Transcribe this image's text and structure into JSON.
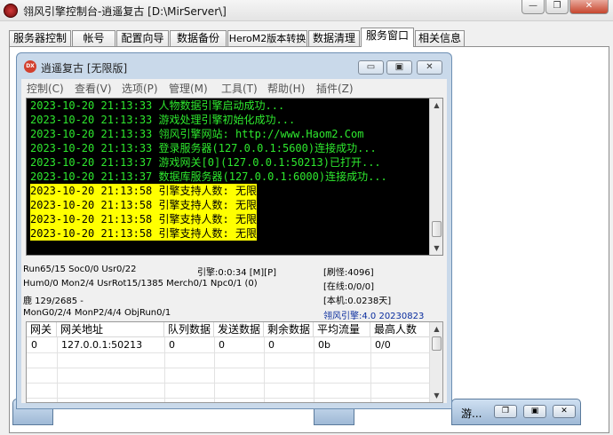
{
  "window": {
    "title": "翎风引擎控制台-逍遥复古 [D:\\MirServer\\]",
    "minimize_glyph": "—",
    "restore_glyph": "❐",
    "close_glyph": "✕"
  },
  "tabs": [
    {
      "label": "服务器控制"
    },
    {
      "label": "帐号"
    },
    {
      "label": "配置向导"
    },
    {
      "label": "数据备份"
    },
    {
      "label": "HeroM2版本转换"
    },
    {
      "label": "数据清理"
    },
    {
      "label": "服务窗口",
      "active": true
    },
    {
      "label": "相关信息"
    }
  ],
  "inner_window": {
    "icon_text": "DX",
    "title": "逍遥复古 [无限版]",
    "min_glyph": "▭",
    "max_glyph": "▣",
    "close_glyph": "✕",
    "menu": [
      "控制(C)",
      "查看(V)",
      "选项(P)",
      "管理(M)",
      "工具(T)",
      "帮助(H)",
      "插件(Z)"
    ]
  },
  "log": [
    {
      "text": "2023-10-20 21:13:33 人物数据引擎启动成功...",
      "highlight": false
    },
    {
      "text": "2023-10-20 21:13:33 游戏处理引擎初始化成功...",
      "highlight": false
    },
    {
      "text": "2023-10-20 21:13:33 翎风引擎网站: http://www.Haom2.Com",
      "highlight": false
    },
    {
      "text": "2023-10-20 21:13:33 登录服务器(127.0.0.1:5600)连接成功...",
      "highlight": false
    },
    {
      "text": "2023-10-20 21:13:37 游戏网关[0](127.0.0.1:50213)已打开...",
      "highlight": false
    },
    {
      "text": "2023-10-20 21:13:37 数据库服务器(127.0.0.1:6000)连接成功...",
      "highlight": false
    },
    {
      "text": "2023-10-20 21:13:58 引擎支持人数: 无限",
      "highlight": true
    },
    {
      "text": "2023-10-20 21:13:58 引擎支持人数: 无限",
      "highlight": true
    },
    {
      "text": "2023-10-20 21:13:58 引擎支持人数: 无限",
      "highlight": true
    },
    {
      "text": "2023-10-20 21:13:58 引擎支持人数: 无限",
      "highlight": true
    }
  ],
  "status": {
    "run": "Run65/15 Soc0/0 Usr0/22",
    "engine_time": "引擎:0:0:34 [M][P]",
    "refresh": "[刷怪:4096]",
    "hum": "Hum0/0 Mon2/4 UsrRot15/1385 Merch0/1 Npc0/1 (0)",
    "online": "[在线:0/0/0]",
    "deer": "鹿 129/2685 -",
    "local": "[本机:0.0238天]",
    "mon": "MonG0/2/4 MonP2/4/4 ObjRun0/1",
    "engine_version": "翎风引擎:4.0 20230823"
  },
  "gateway_table": {
    "headers": [
      "网关",
      "网关地址",
      "队列数据",
      "发送数据",
      "剩余数据",
      "平均流量",
      "最高人数"
    ],
    "rows": [
      [
        "0",
        "127.0.0.1:50213",
        "0",
        "0",
        "0",
        "0b",
        "0/0"
      ]
    ]
  },
  "minimized": [
    {
      "label": "游..."
    }
  ],
  "colors": {
    "log_text": "#2ee82e",
    "log_highlight": "#ffff00",
    "version_text": "#0a2d9e"
  }
}
